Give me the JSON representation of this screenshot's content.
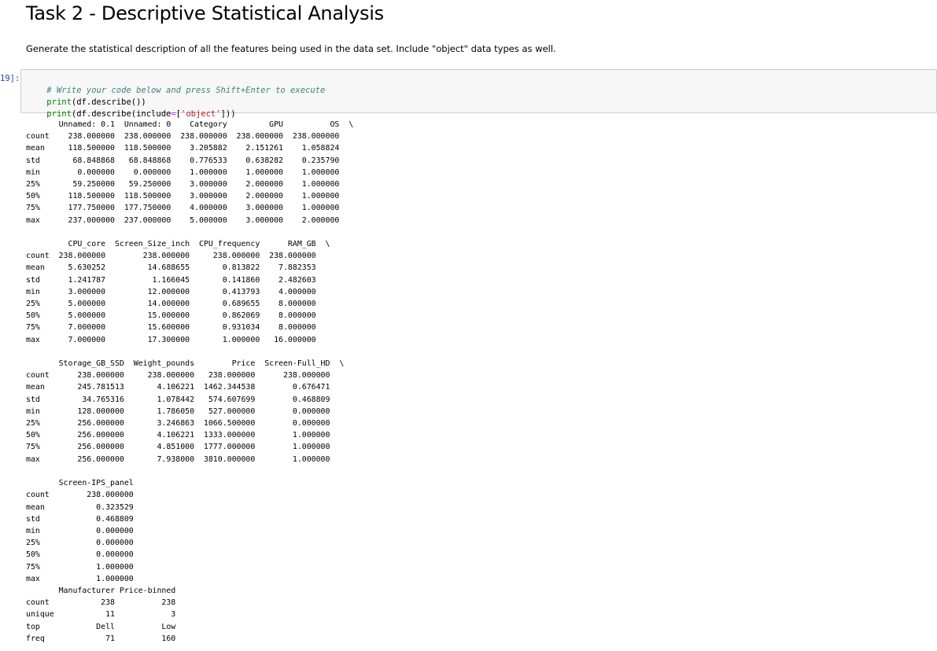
{
  "markdown": {
    "heading": "Task 2 - Descriptive Statistical Analysis",
    "instruction": "Generate the statistical description of all the features being used in the data set. Include \"object\" data types as well."
  },
  "code_cell": {
    "prompt": "19]:",
    "comment": "# Write your code below and press Shift+Enter to execute",
    "line2": {
      "func": "print",
      "args": "(df.describe())"
    },
    "line3": {
      "func": "print",
      "args_a": "(df.describe(include",
      "op": "=",
      "args_b": "[",
      "string": "'object'",
      "args_c": "]))"
    }
  },
  "output": {
    "text": "       Unnamed: 0.1  Unnamed: 0    Category         GPU          OS  \\\ncount    238.000000  238.000000  238.000000  238.000000  238.000000\nmean     118.500000  118.500000    3.205882    2.151261    1.058824\nstd       68.848868   68.848868    0.776533    0.638282    0.235790\nmin        0.000000    0.000000    1.000000    1.000000    1.000000\n25%       59.250000   59.250000    3.000000    2.000000    1.000000\n50%      118.500000  118.500000    3.000000    2.000000    1.000000\n75%      177.750000  177.750000    4.000000    3.000000    1.000000\nmax      237.000000  237.000000    5.000000    3.000000    2.000000\n\n         CPU_core  Screen_Size_inch  CPU_frequency      RAM_GB  \\\ncount  238.000000        238.000000     238.000000  238.000000\nmean     5.630252         14.688655       0.813822    7.882353\nstd      1.241787          1.166045       0.141860    2.482603\nmin      3.000000         12.000000       0.413793    4.000000\n25%      5.000000         14.000000       0.689655    8.000000\n50%      5.000000         15.000000       0.862069    8.000000\n75%      7.000000         15.600000       0.931034    8.000000\nmax      7.000000         17.300000       1.000000   16.000000\n\n       Storage_GB_SSD  Weight_pounds        Price  Screen-Full_HD  \\\ncount      238.000000     238.000000   238.000000      238.000000\nmean       245.781513       4.106221  1462.344538        0.676471\nstd         34.765316       1.078442   574.607699        0.468809\nmin        128.000000       1.786050   527.000000        0.000000\n25%        256.000000       3.246863  1066.500000        0.000000\n50%        256.000000       4.106221  1333.000000        1.000000\n75%        256.000000       4.851000  1777.000000        1.000000\nmax        256.000000       7.938000  3810.000000        1.000000\n\n       Screen-IPS_panel\ncount        238.000000\nmean           0.323529\nstd            0.468809\nmin            0.000000\n25%            0.000000\n50%            0.000000\n75%            1.000000\nmax            1.000000\n       Manufacturer Price-binned\ncount           238          238\nunique           11            3\ntop            Dell          Low\nfreq             71          160"
  }
}
